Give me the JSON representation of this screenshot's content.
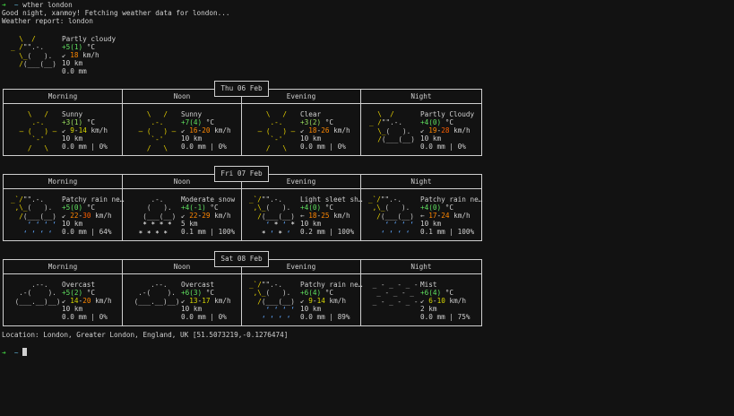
{
  "terminal": {
    "prompt_arrow": "➜",
    "prompt_path": "~",
    "command": "wther london",
    "greeting": "Good night, xanmoy! Fetching weather data for london...",
    "report_label": "Weather report: london",
    "location": "Location: London, Greater London, England, UK [51.5073219,-0.1276474]"
  },
  "current": {
    "icon": "partly-cloudy-icon",
    "desc": "Partly cloudy",
    "temp": "+5(1)",
    "temp_unit": " °C",
    "wind_dir": "↙",
    "wind": "18",
    "wind_unit": " km/h",
    "visibility": "10 km",
    "precip": "0.0 mm"
  },
  "periods": [
    "Morning",
    "Noon",
    "Evening",
    "Night"
  ],
  "days": [
    {
      "date": "Thu 06 Feb",
      "slots": [
        {
          "icon": "sunny-icon",
          "desc": "Sunny",
          "temp": "+3(1)",
          "temp_unit": " °C",
          "wind_dir": "↙",
          "wind_a": "9",
          "wind_sep": "-",
          "wind_b": "14",
          "wind_unit": " km/h",
          "visibility": "10 km",
          "precip": "0.0 mm | 0%"
        },
        {
          "icon": "sunny-icon",
          "desc": "Sunny",
          "temp": "+7(4)",
          "temp_unit": " °C",
          "wind_dir": "↙",
          "wind_a": "16",
          "wind_sep": "-",
          "wind_b": "20",
          "wind_unit": " km/h",
          "visibility": "10 km",
          "precip": "0.0 mm | 0%"
        },
        {
          "icon": "clear-icon",
          "desc": "Clear",
          "temp": "+3(2)",
          "temp_unit": " °C",
          "wind_dir": "↙",
          "wind_a": "18",
          "wind_sep": "-",
          "wind_b": "26",
          "wind_unit": " km/h",
          "visibility": "10 km",
          "precip": "0.0 mm | 0%"
        },
        {
          "icon": "partly-cloudy-icon",
          "desc": "Partly Cloudy",
          "temp": "+4(0)",
          "temp_unit": " °C",
          "wind_dir": "↙",
          "wind_a": "19",
          "wind_sep": "-",
          "wind_b": "28",
          "wind_unit": " km/h",
          "visibility": "10 km",
          "precip": "0.0 mm | 0%"
        }
      ]
    },
    {
      "date": "Fri 07 Feb",
      "slots": [
        {
          "icon": "patchy-rain-icon",
          "desc": "Patchy rain ne…",
          "temp": "+5(0)",
          "temp_unit": " °C",
          "wind_dir": "↙",
          "wind_a": "22",
          "wind_sep": "-",
          "wind_b": "30",
          "wind_unit": " km/h",
          "visibility": "10 km",
          "precip": "0.0 mm | 64%"
        },
        {
          "icon": "moderate-snow-icon",
          "desc": "Moderate snow",
          "temp": "+4(-1)",
          "temp_unit": " °C",
          "wind_dir": "↙",
          "wind_a": "22",
          "wind_sep": "-",
          "wind_b": "29",
          "wind_unit": " km/h",
          "visibility": "5 km",
          "precip": "0.1 mm | 100%"
        },
        {
          "icon": "light-sleet-icon",
          "desc": "Light sleet sh…",
          "temp": "+4(0)",
          "temp_unit": " °C",
          "wind_dir": "←",
          "wind_a": "18",
          "wind_sep": "-",
          "wind_b": "25",
          "wind_unit": " km/h",
          "visibility": "10 km",
          "precip": "0.2 mm | 100%"
        },
        {
          "icon": "patchy-rain-icon",
          "desc": "Patchy rain ne…",
          "temp": "+4(0)",
          "temp_unit": " °C",
          "wind_dir": "←",
          "wind_a": "17",
          "wind_sep": "-",
          "wind_b": "24",
          "wind_unit": " km/h",
          "visibility": "10 km",
          "precip": "0.1 mm | 100%"
        }
      ]
    },
    {
      "date": "Sat 08 Feb",
      "slots": [
        {
          "icon": "overcast-icon",
          "desc": "Overcast",
          "temp": "+5(2)",
          "temp_unit": " °C",
          "wind_dir": "↙",
          "wind_a": "14",
          "wind_sep": "-",
          "wind_b": "20",
          "wind_unit": " km/h",
          "visibility": "10 km",
          "precip": "0.0 mm | 0%"
        },
        {
          "icon": "overcast-icon",
          "desc": "Overcast",
          "temp": "+6(3)",
          "temp_unit": " °C",
          "wind_dir": "↙",
          "wind_a": "13",
          "wind_sep": "-",
          "wind_b": "17",
          "wind_unit": " km/h",
          "visibility": "10 km",
          "precip": "0.0 mm | 0%"
        },
        {
          "icon": "patchy-rain-icon",
          "desc": "Patchy rain ne…",
          "temp": "+6(4)",
          "temp_unit": " °C",
          "wind_dir": "↙",
          "wind_a": "9",
          "wind_sep": "-",
          "wind_b": "14",
          "wind_unit": " km/h",
          "visibility": "10 km",
          "precip": "0.0 mm | 89%"
        },
        {
          "icon": "mist-icon",
          "desc": "Mist",
          "temp": "+6(4)",
          "temp_unit": " °C",
          "wind_dir": "↙",
          "wind_a": "6",
          "wind_sep": "-",
          "wind_b": "10",
          "wind_unit": " km/h",
          "visibility": "2 km",
          "precip": "0.0 mm | 75%"
        }
      ]
    }
  ],
  "colors": {
    "background": "#121212",
    "text": "#d0d0d0",
    "prompt_arrow": "#3ec73e",
    "prompt_path": "#5fb3d6",
    "temp_green": "#5fe05f",
    "wind_yellow": "#d7d700",
    "wind_orange": "#ff8700",
    "sun_yellow": "#e6d000",
    "rain_blue": "#5fa8ff"
  }
}
